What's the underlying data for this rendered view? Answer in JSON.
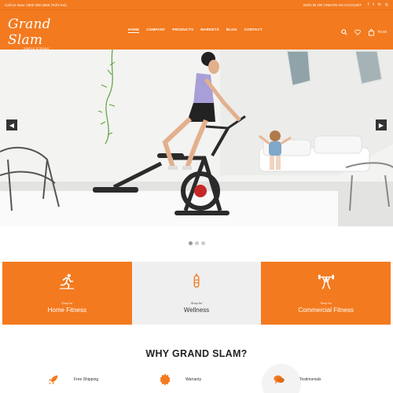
{
  "topbar": {
    "call_text": "Call Us Now: 1800 200 2566 (Toll Free)",
    "account_text": "SIGN IN OR CREATE AN ACCOUNT"
  },
  "header": {
    "logo_text": "Grand Slam",
    "logo_tagline": "SIMPLE STRONG",
    "nav": [
      "HOME",
      "COMPANY",
      "PRODUCTS",
      "MARKETS",
      "BLOG",
      "CONTACT"
    ],
    "cart_text": "₹0.00"
  },
  "hero": {
    "image_desc": ""
  },
  "feature_boxes": [
    {
      "sub": "Shop for",
      "title": "Home Fitness",
      "icon": "running-icon"
    },
    {
      "sub": "Shop for",
      "title": "Wellness",
      "icon": "wellness-icon"
    },
    {
      "sub": "Shop for",
      "title": "Commercial Fitness",
      "icon": "weightlifting-icon"
    }
  ],
  "why": {
    "heading": "WHY GRAND SLAM?",
    "features": [
      {
        "label": "Free Shipping",
        "icon": "rocket-icon"
      },
      {
        "label": "Warranty",
        "icon": "badge-icon"
      },
      {
        "label": "Testimonials",
        "icon": "chat-icon"
      }
    ]
  },
  "colors": {
    "accent": "#f37a1f",
    "grey": "#efefef"
  }
}
